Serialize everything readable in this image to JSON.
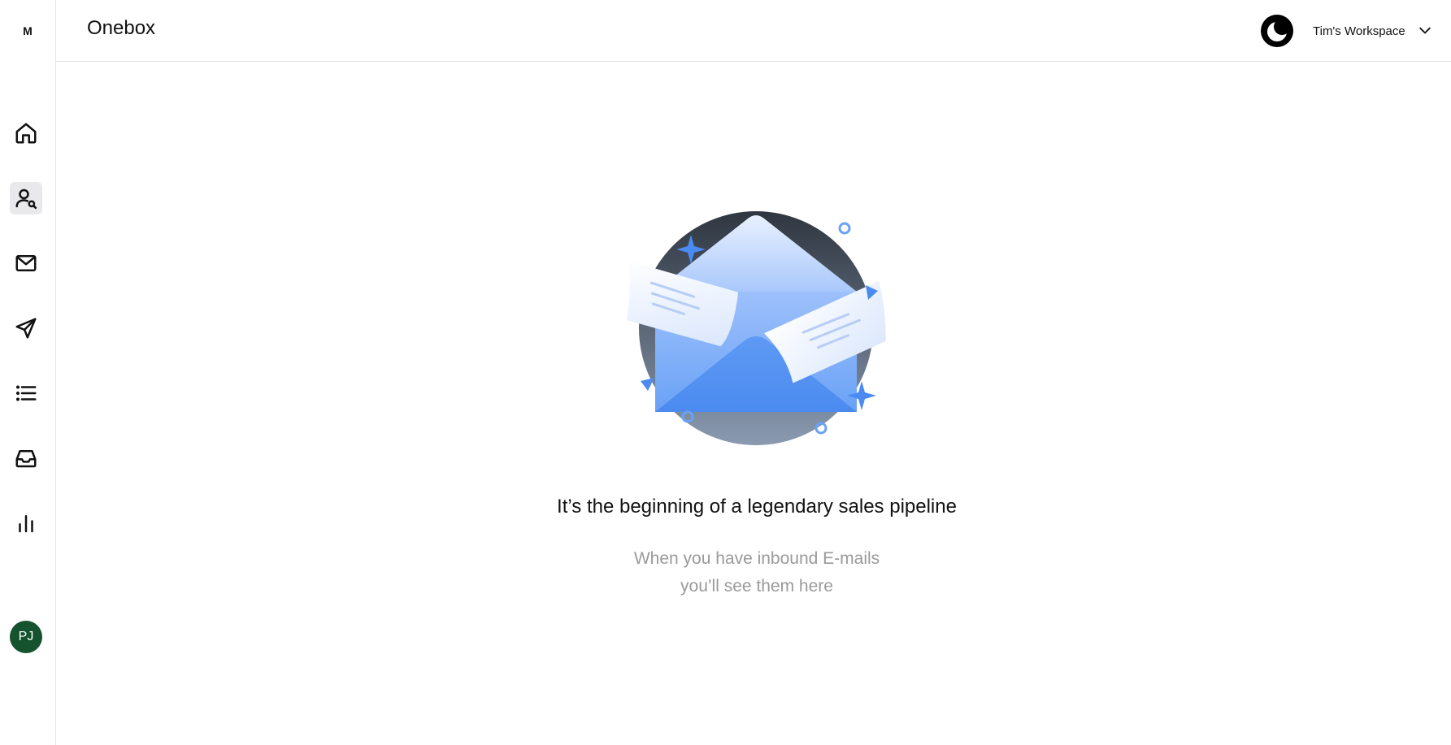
{
  "app": {
    "logo_text": "M",
    "accent": "#5b9cf5"
  },
  "header": {
    "title": "Onebox",
    "theme_toggle_icon": "moon-icon",
    "workspace_name": "Tim's Workspace",
    "workspace_chevron_icon": "chevron-down-icon"
  },
  "sidebar": {
    "items": [
      {
        "name": "home",
        "icon": "home-icon",
        "active": false
      },
      {
        "name": "lead-finder",
        "icon": "user-search-icon",
        "active": true
      },
      {
        "name": "email",
        "icon": "mail-icon",
        "active": false
      },
      {
        "name": "campaigns",
        "icon": "send-icon",
        "active": false
      },
      {
        "name": "lists",
        "icon": "list-icon",
        "active": false
      },
      {
        "name": "onebox",
        "icon": "inbox-icon",
        "active": false
      },
      {
        "name": "analytics",
        "icon": "bar-chart-icon",
        "active": false
      }
    ],
    "avatar_initials": "PJ",
    "avatar_color": "#14532d"
  },
  "empty_state": {
    "title": "It’s the beginning of a legendary sales pipeline",
    "subtitle_line1": "When you have inbound E-mails",
    "subtitle_line2": "you’ll see them here"
  }
}
